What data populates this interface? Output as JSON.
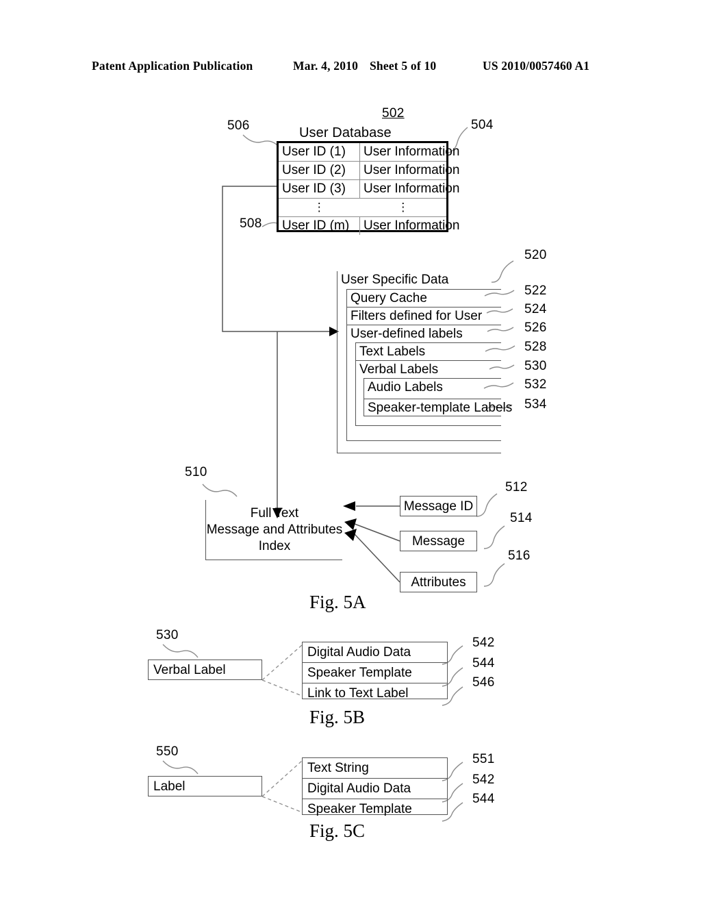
{
  "header": {
    "publication": "Patent Application Publication",
    "date": "Mar. 4, 2010",
    "sheet": "Sheet 5 of 10",
    "patent_number": "US 2010/0057460 A1"
  },
  "fig5a": {
    "caption": "Fig. 5A",
    "user_database": {
      "ref": "502",
      "title": "User Database",
      "ref_rows": "506",
      "ref_info_col": "504",
      "ref_last_row": "508",
      "rows": [
        {
          "id": "User ID (1)",
          "info": "User Information"
        },
        {
          "id": "User ID (2)",
          "info": "User Information"
        },
        {
          "id": "User ID (3)",
          "info": "User Information"
        },
        {
          "id": "⋮",
          "info": "⋮"
        },
        {
          "id": "User ID (m)",
          "info": "User Information"
        }
      ]
    },
    "user_specific_data": {
      "ref": "520",
      "title": "User Specific Data",
      "items": [
        {
          "ref": "522",
          "label": "Query Cache",
          "level": 0
        },
        {
          "ref": "524",
          "label": "Filters defined for User",
          "level": 0
        },
        {
          "ref": "526",
          "label": "User-defined labels",
          "level": 0
        },
        {
          "ref": "528",
          "label": "Text Labels",
          "level": 1
        },
        {
          "ref": "530",
          "label": "Verbal Labels",
          "level": 1
        },
        {
          "ref": "532",
          "label": "Audio Labels",
          "level": 2
        },
        {
          "ref": "534",
          "label": "Speaker-template Labels",
          "level": 2
        }
      ]
    },
    "index": {
      "ref": "510",
      "line1": "Full Text",
      "line2": "Message and Attributes",
      "line3": "Index"
    },
    "sources": [
      {
        "ref": "512",
        "label": "Message ID"
      },
      {
        "ref": "514",
        "label": "Message"
      },
      {
        "ref": "516",
        "label": "Attributes"
      }
    ]
  },
  "fig5b": {
    "caption": "Fig. 5B",
    "source": {
      "ref": "530",
      "label": "Verbal Label"
    },
    "details": [
      {
        "ref": "542",
        "label": "Digital Audio Data"
      },
      {
        "ref": "544",
        "label": "Speaker Template"
      },
      {
        "ref": "546",
        "label": "Link to Text Label"
      }
    ]
  },
  "fig5c": {
    "caption": "Fig. 5C",
    "source": {
      "ref": "550",
      "label": "Label"
    },
    "details": [
      {
        "ref": "551",
        "label": "Text String"
      },
      {
        "ref": "542",
        "label": "Digital Audio Data"
      },
      {
        "ref": "544",
        "label": "Speaker Template"
      }
    ]
  }
}
